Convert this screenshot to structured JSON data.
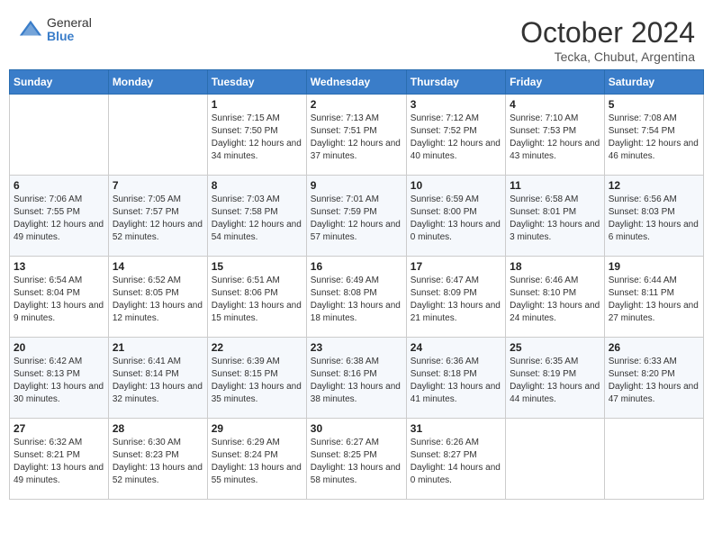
{
  "header": {
    "logo_general": "General",
    "logo_blue": "Blue",
    "month_title": "October 2024",
    "subtitle": "Tecka, Chubut, Argentina"
  },
  "weekdays": [
    "Sunday",
    "Monday",
    "Tuesday",
    "Wednesday",
    "Thursday",
    "Friday",
    "Saturday"
  ],
  "weeks": [
    [
      {
        "day": "",
        "info": ""
      },
      {
        "day": "",
        "info": ""
      },
      {
        "day": "1",
        "info": "Sunrise: 7:15 AM\nSunset: 7:50 PM\nDaylight: 12 hours and 34 minutes."
      },
      {
        "day": "2",
        "info": "Sunrise: 7:13 AM\nSunset: 7:51 PM\nDaylight: 12 hours and 37 minutes."
      },
      {
        "day": "3",
        "info": "Sunrise: 7:12 AM\nSunset: 7:52 PM\nDaylight: 12 hours and 40 minutes."
      },
      {
        "day": "4",
        "info": "Sunrise: 7:10 AM\nSunset: 7:53 PM\nDaylight: 12 hours and 43 minutes."
      },
      {
        "day": "5",
        "info": "Sunrise: 7:08 AM\nSunset: 7:54 PM\nDaylight: 12 hours and 46 minutes."
      }
    ],
    [
      {
        "day": "6",
        "info": "Sunrise: 7:06 AM\nSunset: 7:55 PM\nDaylight: 12 hours and 49 minutes."
      },
      {
        "day": "7",
        "info": "Sunrise: 7:05 AM\nSunset: 7:57 PM\nDaylight: 12 hours and 52 minutes."
      },
      {
        "day": "8",
        "info": "Sunrise: 7:03 AM\nSunset: 7:58 PM\nDaylight: 12 hours and 54 minutes."
      },
      {
        "day": "9",
        "info": "Sunrise: 7:01 AM\nSunset: 7:59 PM\nDaylight: 12 hours and 57 minutes."
      },
      {
        "day": "10",
        "info": "Sunrise: 6:59 AM\nSunset: 8:00 PM\nDaylight: 13 hours and 0 minutes."
      },
      {
        "day": "11",
        "info": "Sunrise: 6:58 AM\nSunset: 8:01 PM\nDaylight: 13 hours and 3 minutes."
      },
      {
        "day": "12",
        "info": "Sunrise: 6:56 AM\nSunset: 8:03 PM\nDaylight: 13 hours and 6 minutes."
      }
    ],
    [
      {
        "day": "13",
        "info": "Sunrise: 6:54 AM\nSunset: 8:04 PM\nDaylight: 13 hours and 9 minutes."
      },
      {
        "day": "14",
        "info": "Sunrise: 6:52 AM\nSunset: 8:05 PM\nDaylight: 13 hours and 12 minutes."
      },
      {
        "day": "15",
        "info": "Sunrise: 6:51 AM\nSunset: 8:06 PM\nDaylight: 13 hours and 15 minutes."
      },
      {
        "day": "16",
        "info": "Sunrise: 6:49 AM\nSunset: 8:08 PM\nDaylight: 13 hours and 18 minutes."
      },
      {
        "day": "17",
        "info": "Sunrise: 6:47 AM\nSunset: 8:09 PM\nDaylight: 13 hours and 21 minutes."
      },
      {
        "day": "18",
        "info": "Sunrise: 6:46 AM\nSunset: 8:10 PM\nDaylight: 13 hours and 24 minutes."
      },
      {
        "day": "19",
        "info": "Sunrise: 6:44 AM\nSunset: 8:11 PM\nDaylight: 13 hours and 27 minutes."
      }
    ],
    [
      {
        "day": "20",
        "info": "Sunrise: 6:42 AM\nSunset: 8:13 PM\nDaylight: 13 hours and 30 minutes."
      },
      {
        "day": "21",
        "info": "Sunrise: 6:41 AM\nSunset: 8:14 PM\nDaylight: 13 hours and 32 minutes."
      },
      {
        "day": "22",
        "info": "Sunrise: 6:39 AM\nSunset: 8:15 PM\nDaylight: 13 hours and 35 minutes."
      },
      {
        "day": "23",
        "info": "Sunrise: 6:38 AM\nSunset: 8:16 PM\nDaylight: 13 hours and 38 minutes."
      },
      {
        "day": "24",
        "info": "Sunrise: 6:36 AM\nSunset: 8:18 PM\nDaylight: 13 hours and 41 minutes."
      },
      {
        "day": "25",
        "info": "Sunrise: 6:35 AM\nSunset: 8:19 PM\nDaylight: 13 hours and 44 minutes."
      },
      {
        "day": "26",
        "info": "Sunrise: 6:33 AM\nSunset: 8:20 PM\nDaylight: 13 hours and 47 minutes."
      }
    ],
    [
      {
        "day": "27",
        "info": "Sunrise: 6:32 AM\nSunset: 8:21 PM\nDaylight: 13 hours and 49 minutes."
      },
      {
        "day": "28",
        "info": "Sunrise: 6:30 AM\nSunset: 8:23 PM\nDaylight: 13 hours and 52 minutes."
      },
      {
        "day": "29",
        "info": "Sunrise: 6:29 AM\nSunset: 8:24 PM\nDaylight: 13 hours and 55 minutes."
      },
      {
        "day": "30",
        "info": "Sunrise: 6:27 AM\nSunset: 8:25 PM\nDaylight: 13 hours and 58 minutes."
      },
      {
        "day": "31",
        "info": "Sunrise: 6:26 AM\nSunset: 8:27 PM\nDaylight: 14 hours and 0 minutes."
      },
      {
        "day": "",
        "info": ""
      },
      {
        "day": "",
        "info": ""
      }
    ]
  ]
}
